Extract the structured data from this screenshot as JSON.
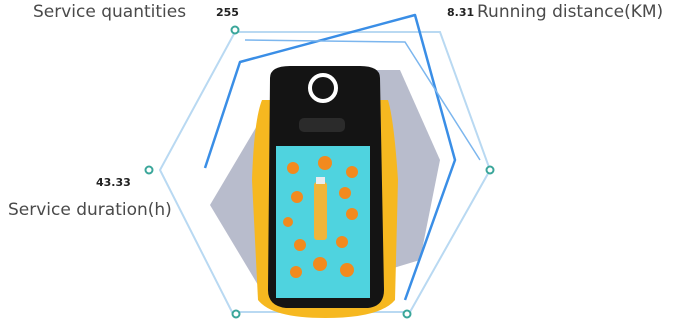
{
  "stats": {
    "service_quantities": {
      "label": "Service quantities",
      "value": "255"
    },
    "running_distance": {
      "label": "Running distance(KM)",
      "value": "8.31"
    },
    "service_duration": {
      "label": "Service duration(h)",
      "value": "43.33"
    }
  },
  "colors": {
    "hex_bright": "#3a8ee6",
    "hex_light": "#b9d9f2",
    "hex_fill": "#b4b8c9",
    "robot_body": "#f6b820",
    "robot_head": "#141414",
    "screen": "#4fd3df",
    "marker": "#3aa69a"
  }
}
